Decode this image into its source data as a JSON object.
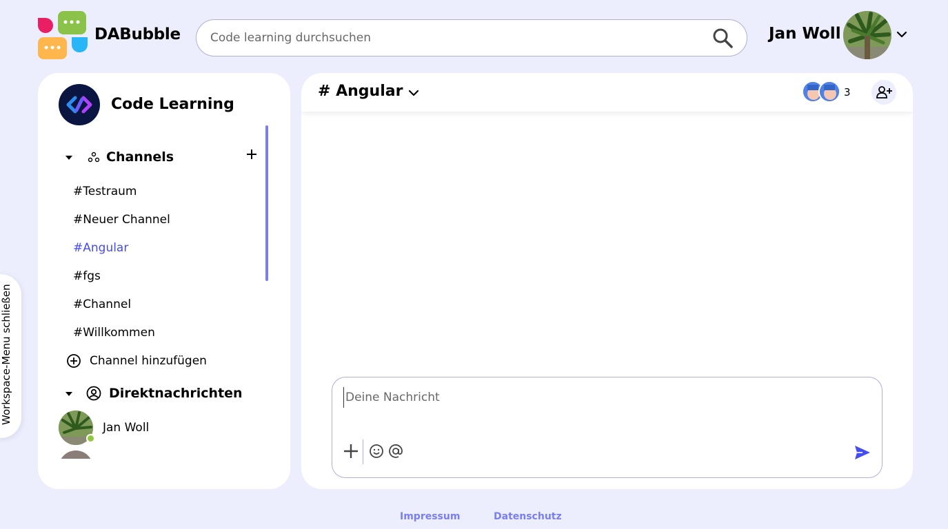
{
  "app": {
    "brand": "DABubble"
  },
  "search": {
    "placeholder": "Code learning durchsuchen"
  },
  "user": {
    "name": "Jan Woll"
  },
  "workspace": {
    "title": "Code Learning",
    "channels_header": "Channels",
    "channels": [
      "#Testraum",
      "#Neuer Channel",
      "#Angular",
      "#fgs",
      "#Channel",
      "#Willkommen"
    ],
    "active_channel": "#Angular",
    "add_channel_label": "Channel hinzufügen",
    "dm_header": "Direktnachrichten",
    "direct_messages": [
      {
        "name": "Jan Woll",
        "online": true
      }
    ]
  },
  "side_tab": {
    "label": "Workspace-Menu schließen"
  },
  "chat": {
    "title": "# Angular",
    "member_count": "3",
    "message_placeholder": "Deine Nachricht"
  },
  "footer": {
    "impressum": "Impressum",
    "datenschutz": "Datenschutz"
  },
  "colors": {
    "background": "#eceefe",
    "accent": "#444df2",
    "scrollbar": "#797ef3",
    "online": "#92c83e"
  },
  "icons": [
    "search-icon",
    "chevron-down-icon",
    "caret-down-icon",
    "channels-icon",
    "plus-icon",
    "add-circle-icon",
    "account-circle-icon",
    "add-member-icon",
    "emoji-icon",
    "at-icon",
    "send-icon"
  ]
}
